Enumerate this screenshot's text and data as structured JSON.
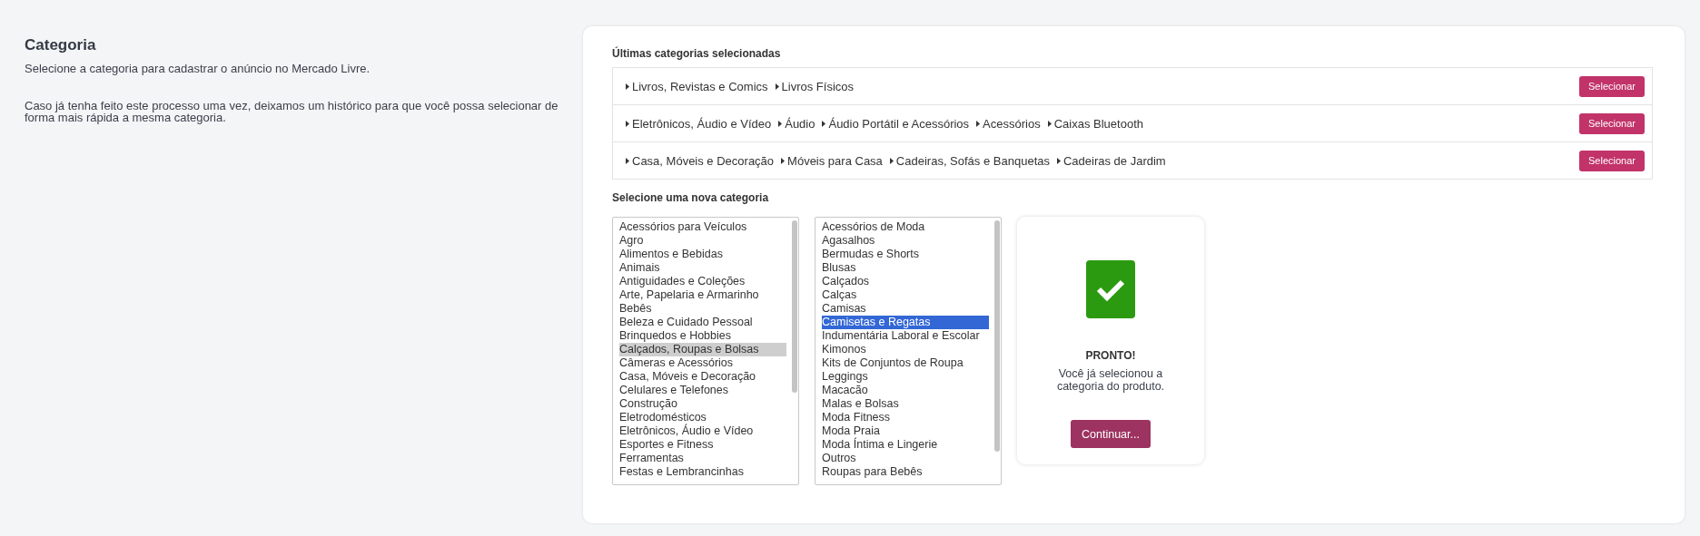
{
  "intro": {
    "title": "Categoria",
    "subtitle": "Selecione a categoria para cadastrar o anúncio no Mercado Livre.",
    "note": "Caso já tenha feito este processo uma vez, deixamos um histórico para que você possa selecionar de forma mais rápida a mesma categoria."
  },
  "history": {
    "title": "Últimas categorias selecionadas",
    "rows": [
      {
        "path": [
          "Livros, Revistas e Comics",
          "Livros Físicos"
        ],
        "button": "Selecionar"
      },
      {
        "path": [
          "Eletrônicos, Áudio e Vídeo",
          "Áudio",
          "Áudio Portátil e Acessórios",
          "Acessórios",
          "Caixas Bluetooth"
        ],
        "button": "Selecionar"
      },
      {
        "path": [
          "Casa, Móveis e Decoração",
          "Móveis para Casa",
          "Cadeiras, Sofás e Banquetas",
          "Cadeiras de Jardim"
        ],
        "button": "Selecionar"
      }
    ]
  },
  "picker": {
    "title": "Selecione uma nova categoria",
    "lists": [
      {
        "focused": false,
        "items": [
          {
            "label": "Acessórios para Veículos",
            "selected": false
          },
          {
            "label": "Agro",
            "selected": false
          },
          {
            "label": "Alimentos e Bebidas",
            "selected": false
          },
          {
            "label": "Animais",
            "selected": false
          },
          {
            "label": "Antiguidades e Coleções",
            "selected": false
          },
          {
            "label": "Arte, Papelaria e Armarinho",
            "selected": false
          },
          {
            "label": "Bebês",
            "selected": false
          },
          {
            "label": "Beleza e Cuidado Pessoal",
            "selected": false
          },
          {
            "label": "Brinquedos e Hobbies",
            "selected": false
          },
          {
            "label": "Calçados, Roupas e Bolsas",
            "selected": true
          },
          {
            "label": "Câmeras e Acessórios",
            "selected": false
          },
          {
            "label": "Casa, Móveis e Decoração",
            "selected": false
          },
          {
            "label": "Celulares e Telefones",
            "selected": false
          },
          {
            "label": "Construção",
            "selected": false
          },
          {
            "label": "Eletrodomésticos",
            "selected": false
          },
          {
            "label": "Eletrônicos, Áudio e Vídeo",
            "selected": false
          },
          {
            "label": "Esportes e Fitness",
            "selected": false
          },
          {
            "label": "Ferramentas",
            "selected": false
          },
          {
            "label": "Festas e Lembrancinhas",
            "selected": false
          }
        ]
      },
      {
        "focused": true,
        "items": [
          {
            "label": "Acessórios de Moda",
            "selected": false
          },
          {
            "label": "Agasalhos",
            "selected": false
          },
          {
            "label": "Bermudas e Shorts",
            "selected": false
          },
          {
            "label": "Blusas",
            "selected": false
          },
          {
            "label": "Calçados",
            "selected": false
          },
          {
            "label": "Calças",
            "selected": false
          },
          {
            "label": "Camisas",
            "selected": false
          },
          {
            "label": "Camisetas e Regatas",
            "selected": true
          },
          {
            "label": "Indumentária Laboral e Escolar",
            "selected": false
          },
          {
            "label": "Kimonos",
            "selected": false
          },
          {
            "label": "Kits de Conjuntos de Roupa",
            "selected": false
          },
          {
            "label": "Leggings",
            "selected": false
          },
          {
            "label": "Macacão",
            "selected": false
          },
          {
            "label": "Malas e Bolsas",
            "selected": false
          },
          {
            "label": "Moda Fitness",
            "selected": false
          },
          {
            "label": "Moda Praia",
            "selected": false
          },
          {
            "label": "Moda Íntima e Lingerie",
            "selected": false
          },
          {
            "label": "Outros",
            "selected": false
          },
          {
            "label": "Roupas para Bebês",
            "selected": false
          }
        ]
      }
    ],
    "done": {
      "title": "PRONTO!",
      "message": "Você já selecionou a categoria do produto.",
      "button": "Continuar..."
    }
  }
}
